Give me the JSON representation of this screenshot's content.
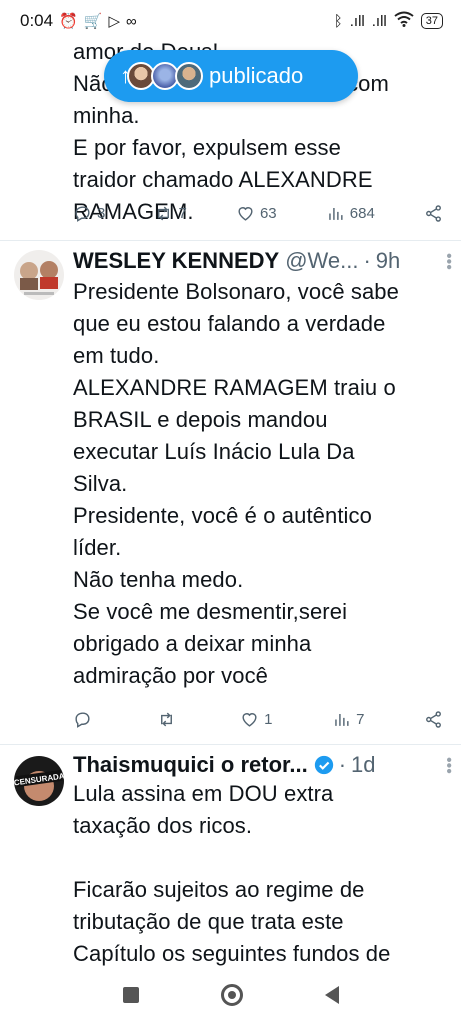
{
  "status_bar": {
    "time": "0:04",
    "battery": "37"
  },
  "pill": {
    "arrow": "↑",
    "label": "publicado"
  },
  "tweet1": {
    "text": "amor de Deus!\nNão deixem isso acontecer com minha.\nE por favor, expulsem esse\ntraidor chamado ALEXANDRE\nRAMAGEM.",
    "replies": "3",
    "retweets": "7",
    "likes": "63",
    "views": "684"
  },
  "tweet2": {
    "name": "WESLEY KENNEDY",
    "handle": "@We...",
    "time": "9h",
    "text": "Presidente Bolsonaro, você sabe\nque eu estou falando a verdade\nem tudo.\nALEXANDRE RAMAGEM traiu o\nBRASIL e depois mandou\nexecutar Luís Inácio Lula Da\nSilva.\nPresidente, você é o autêntico\nlíder.\nNão tenha medo.\nSe você me desmentir,serei\nobrigado a deixar minha\nadmiração por você",
    "replies": "",
    "retweets": "",
    "likes": "1",
    "views": "7"
  },
  "tweet3": {
    "name": "Thaismuquici o retor...",
    "time": "1d",
    "avatar_label": "CENSURADA",
    "text": "Lula assina em DOU extra\ntaxação dos ricos.\n\nFicarão sujeitos ao regime de\ntributação de que trata este\nCapítulo os seguintes fundos de"
  },
  "colors": {
    "accent": "#1d9bf0",
    "text": "#0f1419",
    "muted": "#536471"
  }
}
